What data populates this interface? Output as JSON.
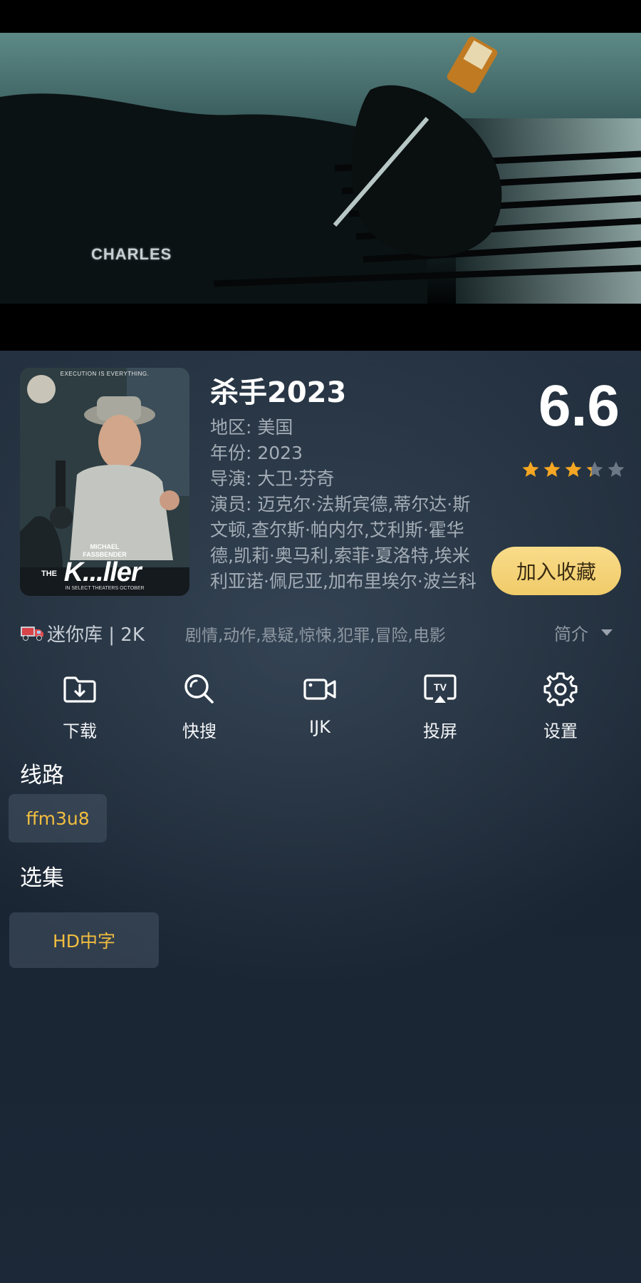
{
  "video": {
    "overlay_text": "CHARLES"
  },
  "poster": {
    "tagline": "EXECUTION IS EVERYTHING.",
    "actor_first": "MICHAEL",
    "actor_last": "FASSBENDER",
    "title_pre": "THE",
    "title_main": "K...ller",
    "release": "IN SELECT THEATERS OCTOBER"
  },
  "movie": {
    "title": "杀手2023",
    "region": "地区: 美国",
    "year": "年份: 2023",
    "director": "导演: 大卫·芬奇",
    "cast": "演员: 迈克尔·法斯宾德,蒂尔达·斯文顿,查尔斯·帕内尔,艾利斯·霍华德,凯莉·奥马利,索菲·夏洛特,埃米利亚诺·佩尼亚,加布里埃尔·波兰科"
  },
  "rating": {
    "score": "6.6",
    "stars_fraction": 0.66,
    "star_color": "#f5a623",
    "star_empty_color": "#6c7885"
  },
  "favorite_button": {
    "label": "加入收藏",
    "color": "#f4d274"
  },
  "source": {
    "label": "迷你库 | 2K",
    "icon": "truck-icon"
  },
  "genres": "剧情,动作,悬疑,惊悚,犯罪,冒险,电影",
  "intro": {
    "label": "简介"
  },
  "actions": [
    {
      "label": "下载",
      "icon": "download-folder-icon"
    },
    {
      "label": "快搜",
      "icon": "search-icon"
    },
    {
      "label": "IJK",
      "icon": "video-camera-icon"
    },
    {
      "label": "投屏",
      "icon": "tv-cast-icon"
    },
    {
      "label": "设置",
      "icon": "gear-icon"
    }
  ],
  "routes": {
    "title": "线路",
    "items": [
      "ffm3u8"
    ]
  },
  "episodes": {
    "title": "选集",
    "items": [
      "HD中字"
    ]
  },
  "accent_color": "#f2be3f"
}
